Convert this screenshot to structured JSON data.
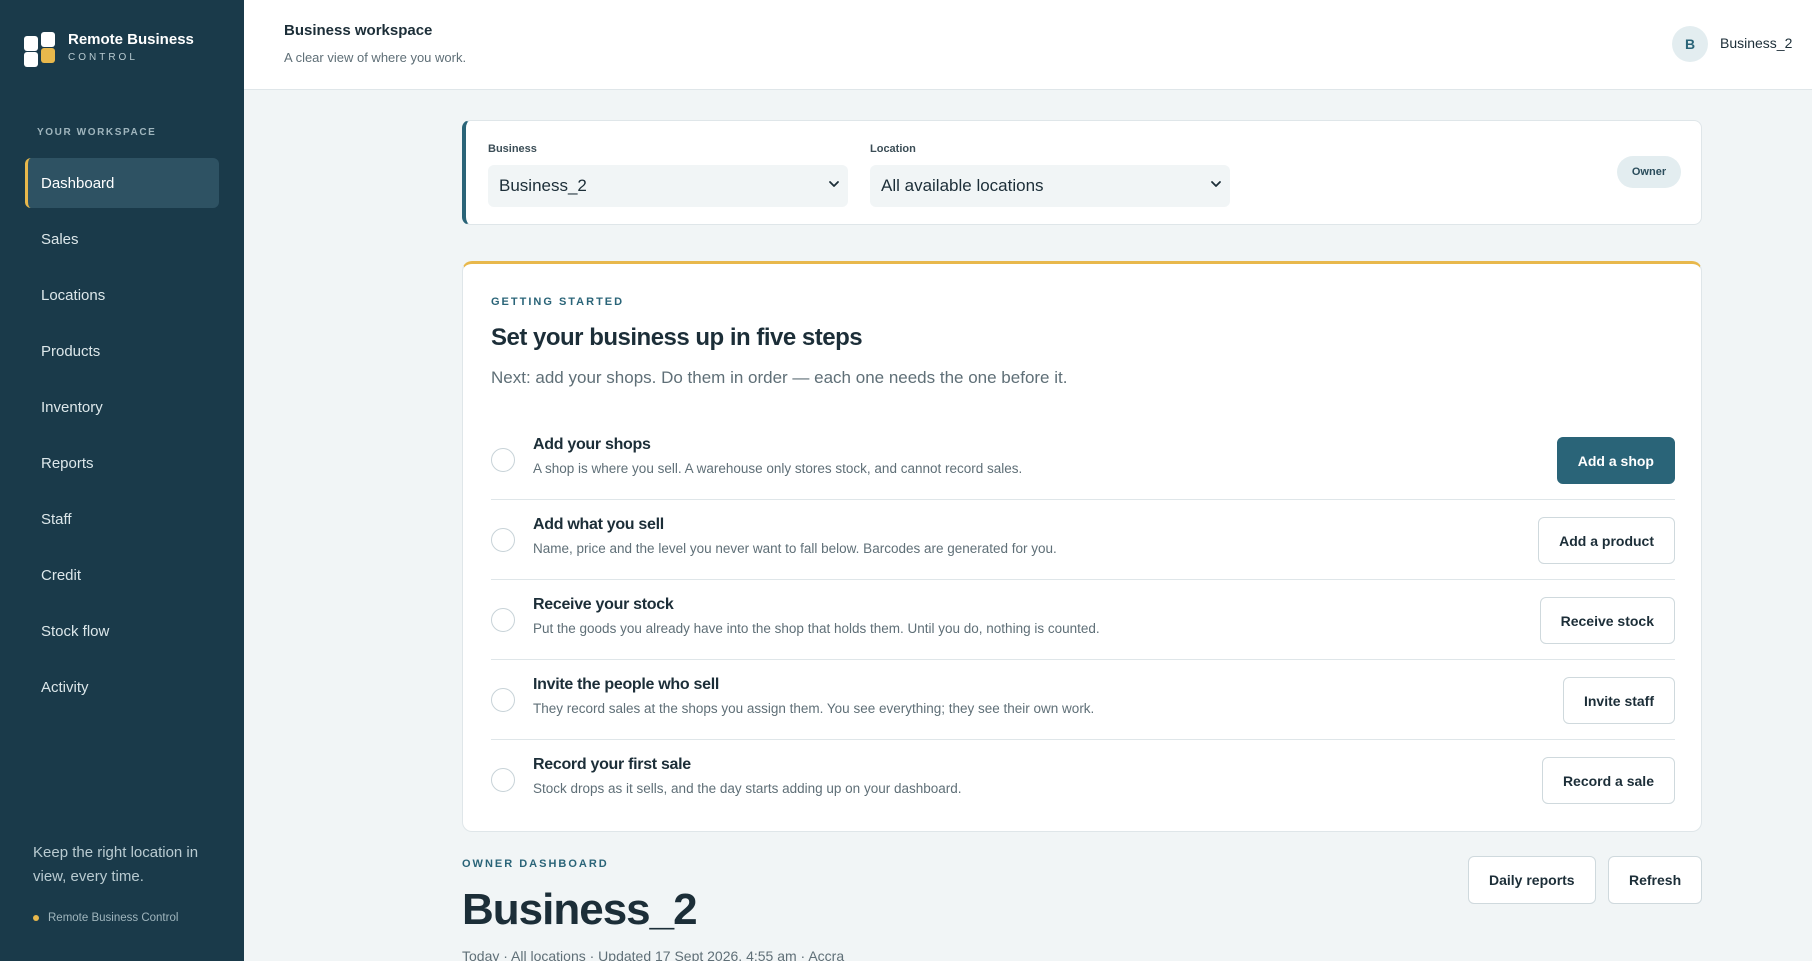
{
  "brand": {
    "name": "Remote Business",
    "sub": "CONTROL"
  },
  "sidebar": {
    "section_label": "YOUR WORKSPACE",
    "items": [
      {
        "label": "Dashboard",
        "active": true
      },
      {
        "label": "Sales"
      },
      {
        "label": "Locations"
      },
      {
        "label": "Products"
      },
      {
        "label": "Inventory"
      },
      {
        "label": "Reports"
      },
      {
        "label": "Staff"
      },
      {
        "label": "Credit"
      },
      {
        "label": "Stock flow"
      },
      {
        "label": "Activity"
      }
    ],
    "footer_text": "Keep the right location in view, every time.",
    "footer_tag": "Remote Business Control"
  },
  "header": {
    "title": "Business workspace",
    "subtitle": "A clear view of where you work.",
    "avatar_initial": "B",
    "user_name": "Business_2"
  },
  "selectors": {
    "business_label": "Business",
    "business_value": "Business_2",
    "location_label": "Location",
    "location_value": "All available locations",
    "role_badge": "Owner"
  },
  "getting_started": {
    "eyebrow": "GETTING STARTED",
    "title": "Set your business up in five steps",
    "description": "Next: add your shops. Do them in order — each one needs the one before it.",
    "steps": [
      {
        "title": "Add your shops",
        "description": "A shop is where you sell. A warehouse only stores stock, and cannot record sales.",
        "action": "Add a shop",
        "primary": true
      },
      {
        "title": "Add what you sell",
        "description": "Name, price and the level you never want to fall below. Barcodes are generated for you.",
        "action": "Add a product"
      },
      {
        "title": "Receive your stock",
        "description": "Put the goods you already have into the shop that holds them. Until you do, nothing is counted.",
        "action": "Receive stock"
      },
      {
        "title": "Invite the people who sell",
        "description": "They record sales at the shops you assign them. You see everything; they see their own work.",
        "action": "Invite staff"
      },
      {
        "title": "Record your first sale",
        "description": "Stock drops as it sells, and the day starts adding up on your dashboard.",
        "action": "Record a sale"
      }
    ]
  },
  "owner_dashboard": {
    "eyebrow": "OWNER DASHBOARD",
    "title": "Business_2",
    "meta": "Today · All locations · Updated 17 Sept 2026, 4:55 am · Accra",
    "daily_reports_label": "Daily reports",
    "refresh_label": "Refresh"
  },
  "colors": {
    "sidebar_bg": "#1a3a4a",
    "accent": "#e8b84c",
    "primary": "#2a6478"
  }
}
